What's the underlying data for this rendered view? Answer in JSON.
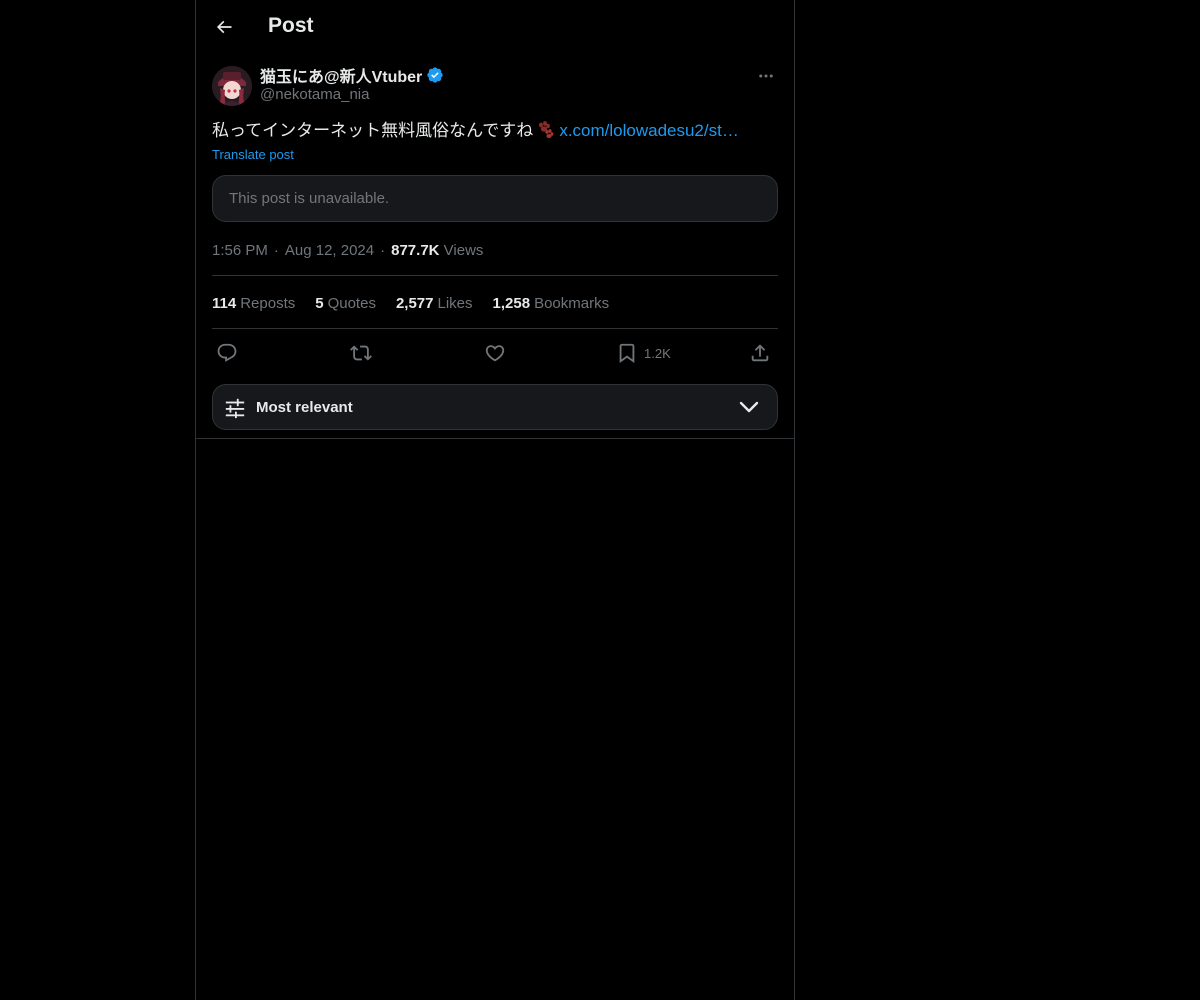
{
  "header": {
    "title": "Post",
    "back_icon": "arrow-left-icon"
  },
  "author": {
    "display_name": "猫玉にあ@新人Vtuber",
    "handle": "@nekotama_nia",
    "verified": true,
    "verified_color": "#1d9bf0"
  },
  "post": {
    "text": "私ってインターネット無料風俗なんですね",
    "emoji_icon": "paw-prints-icon",
    "link_text": "x.com/lolowadesu2/st…",
    "translate_label": "Translate post",
    "quoted_unavailable": "This post is unavailable."
  },
  "meta": {
    "time": "1:56 PM",
    "separator": "·",
    "date": "Aug 12, 2024",
    "views_count": "877.7K",
    "views_label": "Views"
  },
  "stats": [
    {
      "count": "114",
      "label": "Reposts"
    },
    {
      "count": "5",
      "label": "Quotes"
    },
    {
      "count": "2,577",
      "label": "Likes"
    },
    {
      "count": "1,258",
      "label": "Bookmarks"
    }
  ],
  "actions": {
    "reply_icon": "reply-icon",
    "repost_icon": "repost-icon",
    "like_icon": "heart-icon",
    "bookmark_icon": "bookmark-icon",
    "bookmark_count": "1.2K",
    "share_icon": "share-icon"
  },
  "sort": {
    "label": "Most relevant",
    "icon": "sliders-icon",
    "chevron": "chevron-down-icon"
  },
  "colors": {
    "accent": "#1d9bf0",
    "muted": "#71767b",
    "border": "#2f3336",
    "text": "#e7e9ea"
  }
}
